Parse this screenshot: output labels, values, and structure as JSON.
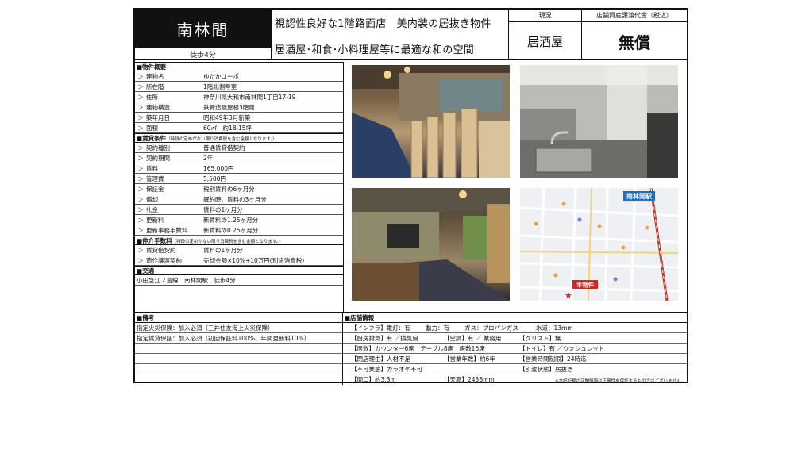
{
  "header": {
    "station": "南林間",
    "walk": "徒歩4分",
    "catch1": "視認性良好な1階路面店　美内装の居抜き物件",
    "catch2": "居酒屋･和食･小料理屋等に最適な和の空間",
    "status_label": "現況",
    "fee_label": "店舗資産譲渡代金（税込）",
    "status_value": "居酒屋",
    "fee_value": "無償"
  },
  "overview": {
    "heading": "■物件概要",
    "rows": [
      {
        "k": "建物名",
        "v": "ゆたかコーポ"
      },
      {
        "k": "所在階",
        "v": "1階北側号室"
      },
      {
        "k": "住所",
        "v": "神奈川県大和市南林間1丁目17-19"
      },
      {
        "k": "建物構造",
        "v": "鉄骨造陸屋根3階建"
      },
      {
        "k": "築年月日",
        "v": "昭和49年3月新築"
      },
      {
        "k": "面積",
        "v": "60㎡　約18.15坪"
      }
    ]
  },
  "lease": {
    "heading": "■賃貸条件",
    "note": "（特段の定めがない限り消費税を含む金額となります。）",
    "rows": [
      {
        "k": "契約種別",
        "v": "普通賃貸借契約"
      },
      {
        "k": "契約期間",
        "v": "2年"
      },
      {
        "k": "賃料",
        "v": "165,000円"
      },
      {
        "k": "管理費",
        "v": "5,500円"
      },
      {
        "k": "保証金",
        "v": "税別賃料の6ヶ月分"
      },
      {
        "k": "償却",
        "v": "解約時、賃料の3ヶ月分"
      },
      {
        "k": "礼金",
        "v": "賃料の1ヶ月分"
      },
      {
        "k": "更新料",
        "v": "新賃料の1.25ヶ月分"
      },
      {
        "k": "更新事務手数料",
        "v": "新賃料の0.25ヶ月分"
      }
    ]
  },
  "brokerage": {
    "heading": "■仲介手数料",
    "note": "（特段の定めがない限り消費税を含む金額となります。）",
    "rows": [
      {
        "k": "賃貸借契約",
        "v": "賃料の1ヶ月分"
      },
      {
        "k": "造作譲渡契約",
        "v": "売却金額×10%+10万円(別途消費税)"
      }
    ]
  },
  "traffic": {
    "heading": "■交通",
    "line": "小田急江ノ島線　南林間駅　徒歩4分"
  },
  "remarks": {
    "heading": "■備考",
    "rows": [
      "指定火災保険：加入必須（三井住友海上火災保険）",
      "指定賃貸保証：加入必須（初回保証料100%、年間更新料10%）"
    ]
  },
  "shop": {
    "heading": "■店舗情報",
    "r1": {
      "a": "【インフラ】電灯：有",
      "b": "動力：有",
      "c": "ガス：プロパンガス",
      "d": "水道：13mm"
    },
    "r2": {
      "a": "【厨房排気】有 ／換気扇",
      "b": "【空調】有 ／ 業務用",
      "c": "【グリスト】無"
    },
    "r3": {
      "a": "【席数】カウンター6席　テーブル8席　座敷16席",
      "b": "【トイレ】有 ／ウォシュレット"
    },
    "r4": {
      "a": "【閉店理由】人材不足",
      "b": "【営業年数】約6年",
      "c": "【営業時間制限】24時迄"
    },
    "r5": {
      "a": "【不可業態】カラオケ不可",
      "b": "【引渡状態】居抜き"
    },
    "r6": {
      "a": "【間口】約3.3m",
      "b": "【天高】2438mm"
    },
    "disclaimer": "※本紙記載の店舗情報は正確性を保証するものではございません。"
  },
  "map": {
    "station_label": "南林間駅",
    "pin_label": "本物件",
    "colors": {
      "station_bg": "#1a6fc4",
      "pin_bg": "#e0201a",
      "rail": "#c0392b"
    }
  },
  "chevron": "＞"
}
